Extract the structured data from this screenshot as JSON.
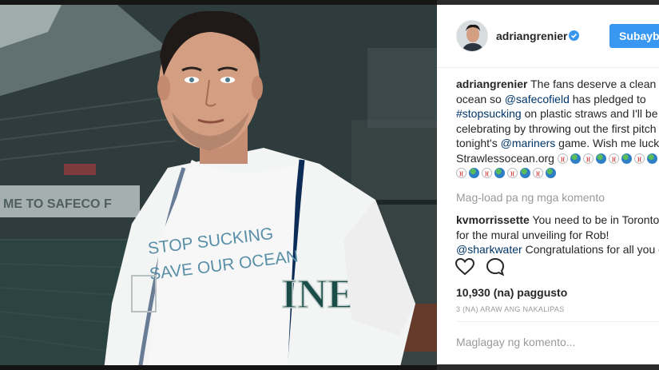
{
  "post": {
    "username": "adriangrenier",
    "follow_label": "Subaybayan",
    "caption": {
      "username": "adriangrenier",
      "text_1": " The fans deserve a clean ocean so ",
      "mention_1": "@safecofield",
      "text_2": " has pledged to ",
      "hashtag_1": "#stopsucking",
      "text_3": " on plastic straws and I'll be celebrating by throwing out the first pitch at tonight's ",
      "mention_2": "@mariners",
      "text_4": " game. Wish me luck. Strawlessocean.org "
    },
    "caption_emojis": [
      "baseball-icon",
      "globe-icon",
      "baseball-icon",
      "globe-icon",
      "baseball-icon",
      "globe-icon",
      "baseball-icon",
      "globe-icon",
      "baseball-icon",
      "globe-icon",
      "baseball-icon",
      "globe-icon",
      "baseball-icon",
      "globe-icon",
      "baseball-icon",
      "globe-icon"
    ],
    "load_more": "Mag-load pa ng mga komento",
    "comment": {
      "username": "kvmorrissette",
      "text_1": " You need to be in Toronto for the mural unveiling for Rob! ",
      "mention_1": "@sharkwater",
      "text_2": " Congratulations for all you do"
    },
    "likes": "10,930 (na) paggusto",
    "timestamp": "3 (NA) ARAW ANG NAKALIPAS",
    "add_comment_placeholder": "Maglagay ng komento..."
  },
  "photo": {
    "shirt_text_line1": "STOP SUCKING",
    "shirt_text_line2": "SAVE OUR OCEAN",
    "jersey_text": "INE",
    "stadium_banner": "ME TO SAFECO F"
  },
  "colors": {
    "follow_button": "#3897f0",
    "link": "#003569",
    "muted": "#999999",
    "verified": "#3897f0"
  }
}
